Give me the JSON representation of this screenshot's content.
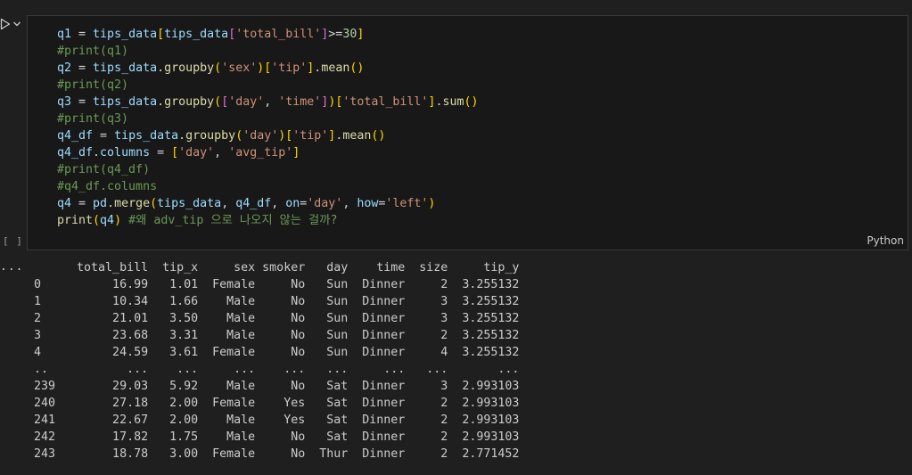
{
  "cell": {
    "exec_count": "[ ]",
    "language": "Python",
    "code": [
      [
        [
          "v",
          "q1"
        ],
        [
          "o",
          " = "
        ],
        [
          "v",
          "tips_data"
        ],
        [
          "b1",
          "["
        ],
        [
          "v",
          "tips_data"
        ],
        [
          "b2",
          "["
        ],
        [
          "s",
          "'total_bill'"
        ],
        [
          "b2",
          "]"
        ],
        [
          "o",
          ">="
        ],
        [
          "n",
          "30"
        ],
        [
          "b1",
          "]"
        ]
      ],
      [
        [
          "c",
          "#print(q1)"
        ]
      ],
      [
        [
          "v",
          "q2"
        ],
        [
          "o",
          " = "
        ],
        [
          "v",
          "tips_data"
        ],
        [
          "o",
          "."
        ],
        [
          "f",
          "groupby"
        ],
        [
          "b1",
          "("
        ],
        [
          "s",
          "'sex'"
        ],
        [
          "b1",
          ")"
        ],
        [
          "b1",
          "["
        ],
        [
          "s",
          "'tip'"
        ],
        [
          "b1",
          "]"
        ],
        [
          "o",
          "."
        ],
        [
          "f",
          "mean"
        ],
        [
          "b1",
          "()"
        ]
      ],
      [
        [
          "c",
          "#print(q2)"
        ]
      ],
      [
        [
          "v",
          "q3"
        ],
        [
          "o",
          " = "
        ],
        [
          "v",
          "tips_data"
        ],
        [
          "o",
          "."
        ],
        [
          "f",
          "groupby"
        ],
        [
          "b1",
          "("
        ],
        [
          "b2",
          "["
        ],
        [
          "s",
          "'day'"
        ],
        [
          "o",
          ", "
        ],
        [
          "s",
          "'time'"
        ],
        [
          "b2",
          "]"
        ],
        [
          "b1",
          ")"
        ],
        [
          "b1",
          "["
        ],
        [
          "s",
          "'total_bill'"
        ],
        [
          "b1",
          "]"
        ],
        [
          "o",
          "."
        ],
        [
          "f",
          "sum"
        ],
        [
          "b1",
          "()"
        ]
      ],
      [
        [
          "c",
          "#print(q3)"
        ]
      ],
      [
        [
          "v",
          "q4_df"
        ],
        [
          "o",
          " = "
        ],
        [
          "v",
          "tips_data"
        ],
        [
          "o",
          "."
        ],
        [
          "f",
          "groupby"
        ],
        [
          "b1",
          "("
        ],
        [
          "s",
          "'day'"
        ],
        [
          "b1",
          ")"
        ],
        [
          "b1",
          "["
        ],
        [
          "s",
          "'tip'"
        ],
        [
          "b1",
          "]"
        ],
        [
          "o",
          "."
        ],
        [
          "f",
          "mean"
        ],
        [
          "b1",
          "()"
        ]
      ],
      [
        [
          "v",
          "q4_df"
        ],
        [
          "o",
          "."
        ],
        [
          "v",
          "columns"
        ],
        [
          "o",
          " = "
        ],
        [
          "b1",
          "["
        ],
        [
          "s",
          "'day'"
        ],
        [
          "o",
          ", "
        ],
        [
          "s",
          "'avg_tip'"
        ],
        [
          "b1",
          "]"
        ]
      ],
      [
        [
          "c",
          "#print(q4_df)"
        ]
      ],
      [
        [
          "c",
          "#q4_df.columns"
        ]
      ],
      [
        [
          "v",
          "q4"
        ],
        [
          "o",
          " = "
        ],
        [
          "v",
          "pd"
        ],
        [
          "o",
          "."
        ],
        [
          "f",
          "merge"
        ],
        [
          "b1",
          "("
        ],
        [
          "v",
          "tips_data"
        ],
        [
          "o",
          ", "
        ],
        [
          "v",
          "q4_df"
        ],
        [
          "o",
          ", "
        ],
        [
          "v",
          "on"
        ],
        [
          "o",
          "="
        ],
        [
          "s",
          "'day'"
        ],
        [
          "o",
          ", "
        ],
        [
          "v",
          "how"
        ],
        [
          "o",
          "="
        ],
        [
          "s",
          "'left'"
        ],
        [
          "b1",
          ")"
        ]
      ],
      [
        [
          "f",
          "print"
        ],
        [
          "b1",
          "("
        ],
        [
          "v",
          "q4"
        ],
        [
          "b1",
          ")"
        ],
        [
          "o",
          " "
        ],
        [
          "c",
          "#왜 adv_tip 으로 나오지 않는 걸까?"
        ]
      ]
    ]
  },
  "output": {
    "menu_label": "...",
    "lines": [
      "      total_bill  tip_x     sex smoker   day    time  size     tip_y",
      "0          16.99   1.01  Female     No   Sun  Dinner     2  3.255132",
      "1          10.34   1.66    Male     No   Sun  Dinner     3  3.255132",
      "2          21.01   3.50    Male     No   Sun  Dinner     3  3.255132",
      "3          23.68   3.31    Male     No   Sun  Dinner     2  3.255132",
      "4          24.59   3.61  Female     No   Sun  Dinner     4  3.255132",
      "..           ...    ...     ...    ...   ...     ...   ...       ...",
      "239        29.03   5.92    Male     No   Sat  Dinner     3  2.993103",
      "240        27.18   2.00  Female    Yes   Sat  Dinner     2  2.993103",
      "241        22.67   2.00    Male    Yes   Sat  Dinner     2  2.993103",
      "242        17.82   1.75    Male     No   Sat  Dinner     2  2.993103",
      "243        18.78   3.00  Female     No  Thur  Dinner     2  2.771452"
    ]
  }
}
